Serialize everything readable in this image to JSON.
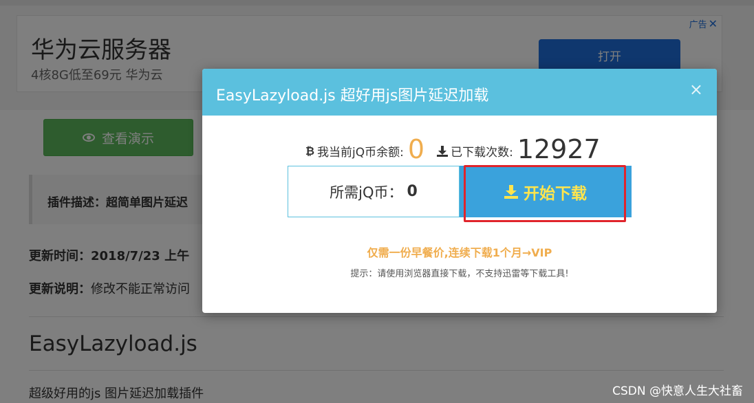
{
  "ad": {
    "title": "华为云服务器",
    "subtitle": "4核8G低至69元 华为云",
    "open_button": "打开",
    "tag": "广告"
  },
  "page": {
    "demo_button": "查看演示",
    "desc_label": "插件描述：超简单图片延迟",
    "update_time_label": "更新时间：",
    "update_time_value": "2018/7/23 上午",
    "update_note_label": "更新说明：",
    "update_note_value": "修改不能正常访问",
    "plugin_name": "EasyLazyload.js",
    "plugin_desc": "超级好用的js 图片延迟加载插件"
  },
  "modal": {
    "title": "EasyLazyload.js 超好用js图片延迟加载",
    "close": "×",
    "balance_label": "我当前jQ币余额:",
    "balance_value": "0",
    "downloads_label": "已下载次数:",
    "downloads_value": "12927",
    "cost_label": "所需jQ币：",
    "cost_value": "0",
    "download_button": "开始下载",
    "vip_text": "仅需一份早餐价,连续下载1个月→VIP",
    "tip_text": "提示：请使用浏览器直接下载，不支持迅雷等下载工具!"
  },
  "watermark": "CSDN @快意人生大社畜",
  "icons": {
    "balance": "bitcoin-icon",
    "downloads": "download-icon",
    "demo": "eye-icon"
  },
  "colors": {
    "modal_header": "#5bc0de",
    "download_button": "#3aa2dc",
    "download_label": "#ffe54d",
    "balance_value": "#f0ad4e",
    "demo_button": "#5cb85c",
    "highlight": "#e0242b"
  }
}
